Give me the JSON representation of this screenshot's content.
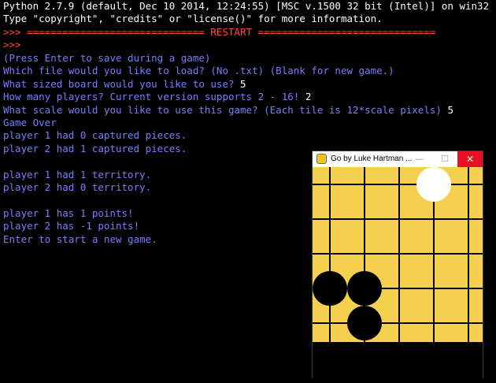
{
  "console": {
    "lines": [
      {
        "text": "Python 2.7.9 (default, Dec 10 2014, 12:24:55) [MSC v.1500 32 bit (Intel)] on win32",
        "color": "#ffffff"
      },
      {
        "text": "Type \"copyright\", \"credits\" or \"license()\" for more information.",
        "color": "#ffffff"
      },
      {
        "text": ">>> ============================== RESTART ==============================",
        "color": "#ff4b3a",
        "prompt": ">>> "
      },
      {
        "text": ">>>",
        "color": "#ff4b3a"
      },
      {
        "text": "(Press Enter to save during a game)",
        "color": "#7b7bff"
      },
      {
        "text": "Which file would you like to load? (No .txt) (Blank for new game.)",
        "color": "#7b7bff"
      },
      {
        "text": "What sized board would you like to use? ",
        "color": "#7b7bff",
        "input": "5"
      },
      {
        "text": "How many players? Current version supports 2 - 16! ",
        "color": "#7b7bff",
        "input": "2"
      },
      {
        "text": "What scale would you like to use this game? (Each tile is 12*scale pixels) ",
        "color": "#7b7bff",
        "input": "5"
      },
      {
        "text": "Game Over",
        "color": "#7b7bff"
      },
      {
        "text": "player 1 had 0 captured pieces.",
        "color": "#7b7bff"
      },
      {
        "text": "player 2 had 1 captured pieces.",
        "color": "#7b7bff"
      },
      {
        "text": "",
        "color": "#7b7bff"
      },
      {
        "text": "player 1 had 1 territory.",
        "color": "#7b7bff"
      },
      {
        "text": "player 2 had 0 territory.",
        "color": "#7b7bff"
      },
      {
        "text": "",
        "color": "#7b7bff"
      },
      {
        "text": "player 1 has 1 points!",
        "color": "#7b7bff"
      },
      {
        "text": "player 2 has -1 points!",
        "color": "#7b7bff"
      },
      {
        "text": "Enter to start a new game.",
        "color": "#7b7bff"
      }
    ]
  },
  "game_window": {
    "title": "Go by Luke Hartman ...",
    "minimize": "—",
    "maximize": "☐",
    "close": "✕",
    "board": {
      "size": 5,
      "board_color": "#f5d04f",
      "line_color": "#000000",
      "stones": [
        {
          "col": 3,
          "row": 0,
          "color": "white"
        },
        {
          "col": 0,
          "row": 3,
          "color": "black"
        },
        {
          "col": 1,
          "row": 3,
          "color": "black"
        },
        {
          "col": 1,
          "row": 4,
          "color": "black"
        }
      ]
    }
  }
}
